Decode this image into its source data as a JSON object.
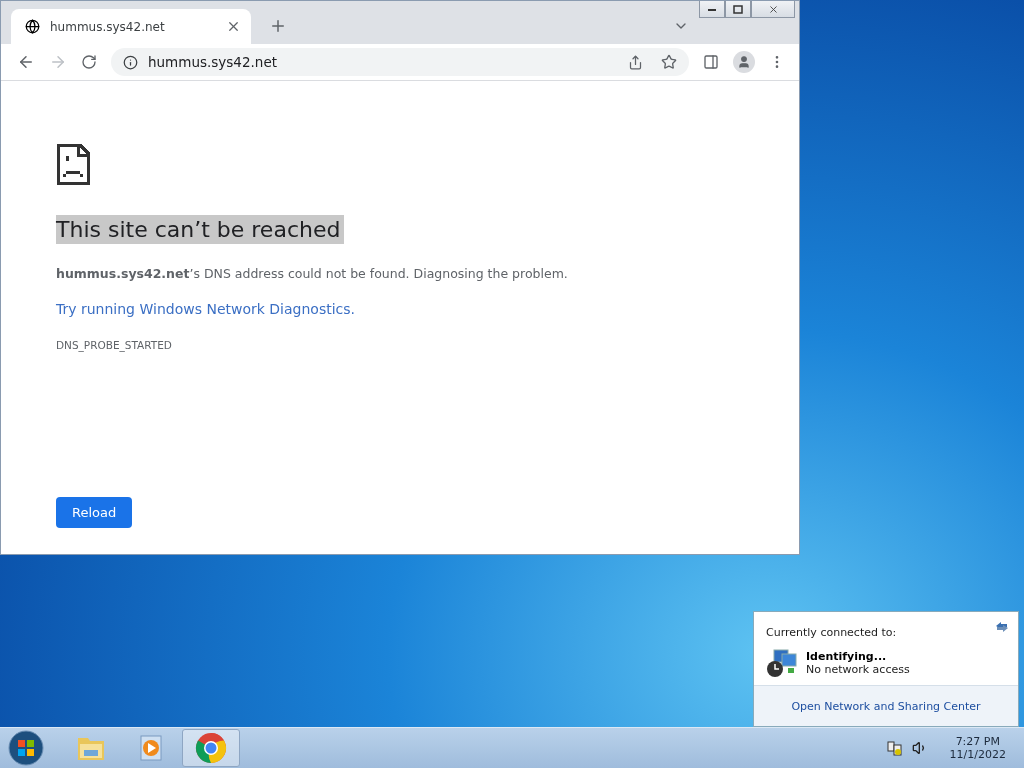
{
  "browser": {
    "tab": {
      "title": "hummus.sys42.net",
      "selected": true
    },
    "forward": {
      "disabled": true
    },
    "address": "hummus.sys42.net",
    "error": {
      "title": "This site can’t be reached",
      "title_selected": true,
      "message": "**hummus.sys42.net**’s DNS address could not be found. Diagnosing the problem.",
      "link": "Try running Windows Network Diagnostics.",
      "code": "DNS_PROBE_STARTED",
      "button": "Reload"
    }
  },
  "network_popup": {
    "heading": "Currently connected to:",
    "network": "Identifying...",
    "status": "No network access",
    "link": "Open Network and Sharing Center"
  },
  "taskbar": {
    "apps": [
      {
        "kind": "explorer",
        "selected": false
      },
      {
        "kind": "media",
        "selected": false
      },
      {
        "kind": "chrome",
        "selected": true
      }
    ],
    "time": "7:27 PM",
    "date": "11/1/2022"
  }
}
